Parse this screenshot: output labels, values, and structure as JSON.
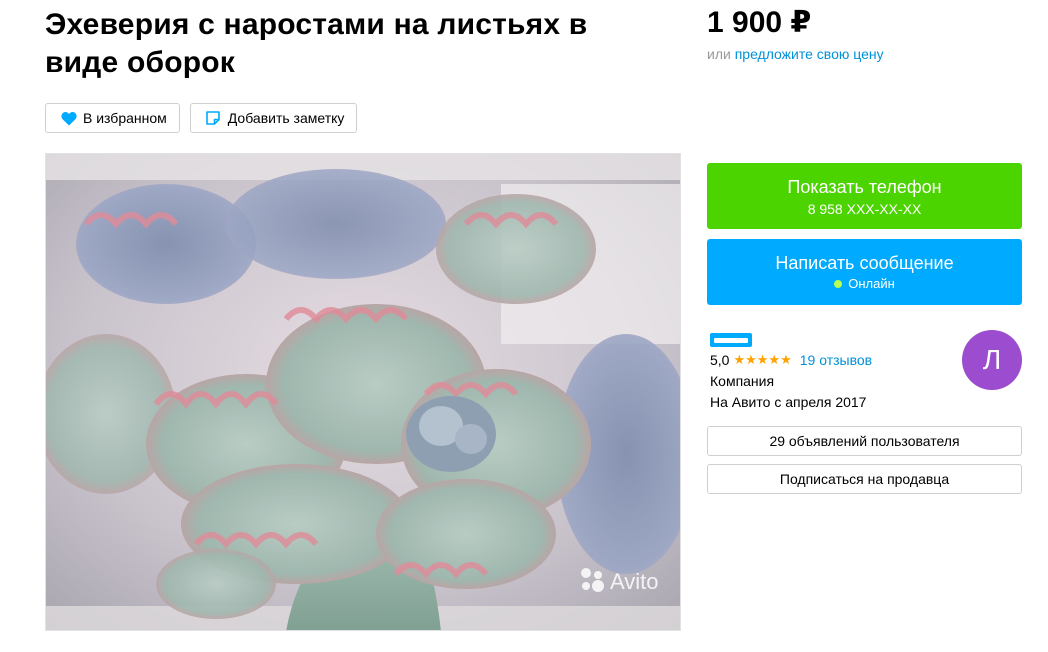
{
  "listing": {
    "title": "Эхеверия с наростами на листьях в виде оборок",
    "price": "1 900 ₽",
    "price_offer_prefix": "или ",
    "price_offer_link": "предложите свою цену"
  },
  "actions": {
    "favorite_label": "В избранном",
    "note_label": "Добавить заметку"
  },
  "gallery": {
    "watermark": "Avito"
  },
  "contact": {
    "show_phone_label": "Показать телефон",
    "phone_masked": "8 958 XXX-XX-XX",
    "message_label": "Написать сообщение",
    "online_label": "Онлайн"
  },
  "seller": {
    "rating": "5,0",
    "stars": "★★★★★",
    "reviews": "19 отзывов",
    "type": "Компания",
    "since": "На Авито с апреля 2017",
    "avatar_letter": "Л",
    "ads_count_label": "29 объявлений пользователя",
    "subscribe_label": "Подписаться на продавца"
  },
  "colors": {
    "green": "#4cd400",
    "blue": "#00aaff",
    "link": "#0091d9",
    "avatar": "#9b4ccf"
  },
  "icons": {
    "favorite": "heart-icon",
    "note": "note-icon",
    "online": "online-dot"
  }
}
